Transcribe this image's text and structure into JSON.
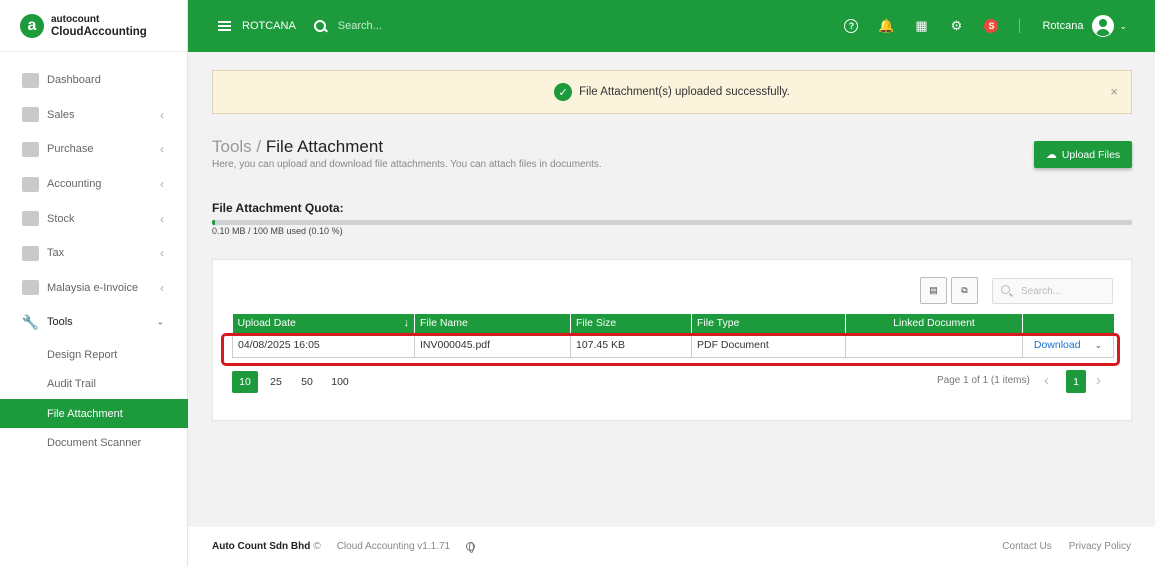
{
  "brand": {
    "top": "autocount",
    "bottom": "CloudAccounting",
    "mark": "a"
  },
  "header": {
    "company": "ROTCANA",
    "search_placeholder": "Search...",
    "user": "Rotcana",
    "badge_letter": "S"
  },
  "sidebar": {
    "items": [
      {
        "label": "Dashboard",
        "icon": "dashboard-icon"
      },
      {
        "label": "Sales",
        "icon": "sales-icon"
      },
      {
        "label": "Purchase",
        "icon": "purchase-icon"
      },
      {
        "label": "Accounting",
        "icon": "accounting-icon"
      },
      {
        "label": "Stock",
        "icon": "stock-icon"
      },
      {
        "label": "Tax",
        "icon": "tax-icon"
      },
      {
        "label": "Malaysia e-Invoice",
        "icon": "einvoice-icon"
      },
      {
        "label": "Tools",
        "icon": "wrench-icon"
      }
    ],
    "tools_sub": [
      {
        "label": "Design Report"
      },
      {
        "label": "Audit Trail"
      },
      {
        "label": "File Attachment"
      },
      {
        "label": "Document Scanner"
      }
    ]
  },
  "alert": {
    "message": "File Attachment(s) uploaded successfully."
  },
  "page": {
    "crumb_parent": "Tools",
    "crumb_separator": "/",
    "title": "File Attachment",
    "subtitle": "Here, you can upload and download file attachments. You can attach files in documents.",
    "upload_label": "Upload Files"
  },
  "quota": {
    "title": "File Attachment Quota:",
    "used_fraction": 0.001,
    "text": "0.10 MB / 100 MB used (0.10 %)"
  },
  "table": {
    "search_placeholder": "Search...",
    "columns": [
      "Upload Date",
      "File Name",
      "File Size",
      "File Type",
      "Linked Document",
      ""
    ],
    "rows": [
      {
        "upload_date": "04/08/2025 16:05",
        "file_name": "INV000045.pdf",
        "file_size": "107.45 KB",
        "file_type": "PDF Document",
        "linked_document": "",
        "action": "Download"
      }
    ]
  },
  "pagination": {
    "sizes": [
      "10",
      "25",
      "50",
      "100"
    ],
    "active_size": "10",
    "info": "Page 1 of 1 (1 items)",
    "current_page": "1"
  },
  "footer": {
    "company": "Auto Count Sdn Bhd",
    "copyright": "©",
    "version": "Cloud Accounting v1.1.71",
    "contact": "Contact Us",
    "privacy": "Privacy Policy"
  },
  "colors": {
    "brand_green": "#1c9a3c",
    "alert_bg": "#fcf3dc",
    "highlight_red": "#d71920",
    "link_blue": "#1a6fd0"
  }
}
